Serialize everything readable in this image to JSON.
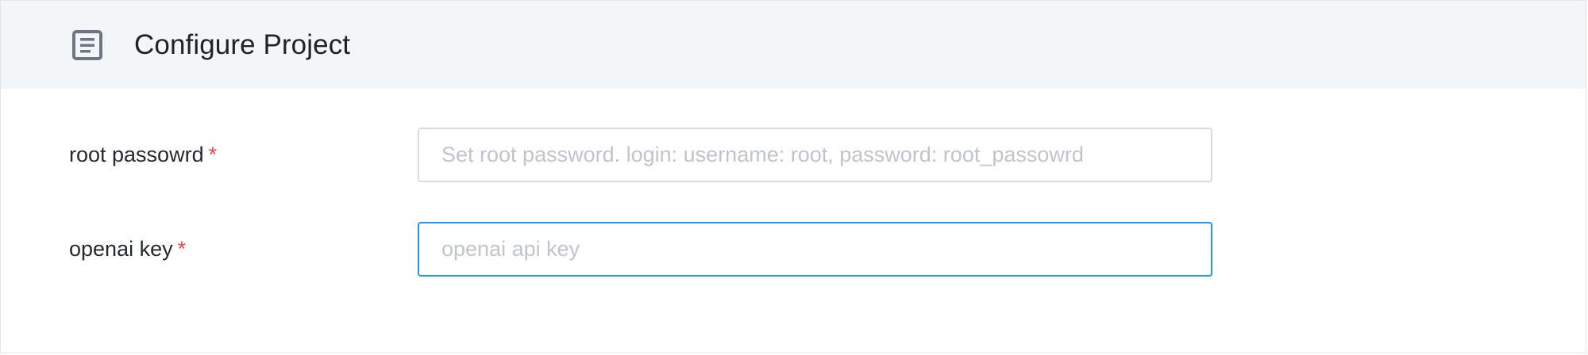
{
  "header": {
    "icon": "document-icon",
    "title": "Configure Project"
  },
  "form": {
    "fields": [
      {
        "label": "root passowrd",
        "required_mark": "*",
        "value": "",
        "placeholder": "Set root password. login: username: root, password: root_passowrd",
        "focused": false
      },
      {
        "label": "openai key",
        "required_mark": "*",
        "value": "",
        "placeholder": "openai api key",
        "focused": true
      }
    ]
  },
  "colors": {
    "header_background": "#f3f6f9",
    "required": "#e5484d",
    "focus_border": "#2496ed",
    "placeholder": "#c0c4cc"
  }
}
